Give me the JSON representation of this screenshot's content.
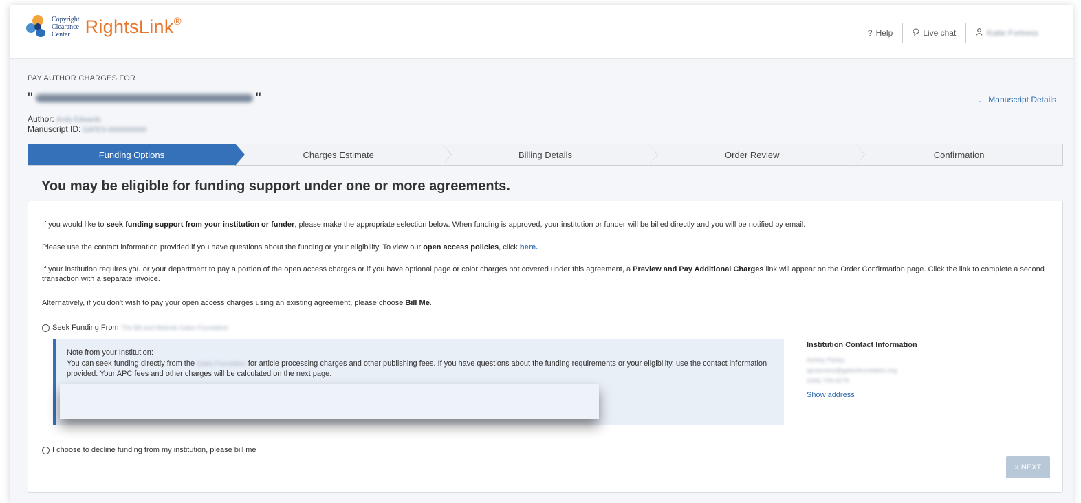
{
  "header": {
    "logo_line1": "Copyright",
    "logo_line2": "Clearance",
    "logo_line3": "Center",
    "brand": "RightsLink",
    "brand_mark": "®",
    "help": "Help",
    "help_icon": "question-icon",
    "live_chat": "Live chat",
    "chat_icon": "chat-bubble-icon",
    "user_icon": "user-icon",
    "user_name": "Katie Fortress"
  },
  "manuscript": {
    "pay_label": "PAY AUTHOR CHARGES FOR",
    "quote_open": "\"",
    "quote_close": "\"",
    "title_redacted": "Test-manuscript-FinalTitle",
    "author_label": "Author:",
    "author_value": "Andy Edwards",
    "id_label": "Manuscript ID:",
    "id_value": "GATES-0000000000",
    "details_link": "Manuscript Details",
    "details_icon": "chevron-down-icon"
  },
  "steps": [
    {
      "label": "Funding Options",
      "active": true
    },
    {
      "label": "Charges Estimate",
      "active": false
    },
    {
      "label": "Billing Details",
      "active": false
    },
    {
      "label": "Order Review",
      "active": false
    },
    {
      "label": "Confirmation",
      "active": false
    }
  ],
  "main": {
    "heading": "You may be eligible for funding support under one or more agreements.",
    "p1_a": "If you would like to ",
    "p1_b": "seek funding support from your institution or funder",
    "p1_c": ", please make the appropriate selection below. When funding is approved, your institution or funder will be billed directly and you will be notified by email.",
    "p2_a": "Please use the contact information provided if you have questions about the funding or your eligibility. To view our ",
    "p2_b": "open access policies",
    "p2_c": ", click ",
    "p2_link": "here.",
    "p3_a": "If your institution requires you or your department to pay a portion of the open access charges or if you have optional page or color charges not covered under this agreement, a ",
    "p3_b": "Preview and Pay Additional Charges",
    "p3_c": " link will appear on the Order Confirmation page. Click the link to complete a second transaction with a separate invoice.",
    "p4_a": "Alternatively, if you don't wish to pay your open access charges using an existing agreement, please choose ",
    "p4_b": "Bill Me",
    "p4_c": ".",
    "seek_label": "Seek Funding From",
    "seek_org": "The Bill and Melinda Gates Foundation",
    "note_title": "Note from your Institution:",
    "note_a": "You can seek funding directly from the ",
    "note_org": "Gates Foundation",
    "note_b": " for article processing charges and other publishing fees. If you have questions about the funding requirements or your eligibility, use the contact information provided.  Your APC fees and other charges will be calculated on the next page.",
    "contact_title": "Institution Contact Information",
    "contact_name": "Ashley Parley",
    "contact_email": "apcaccess@gatesfoundation.org",
    "contact_phone": "(206) 709-4279",
    "show_address": "Show address",
    "decline_label": "I choose to decline funding from my institution, please bill me",
    "next_label": "» NEXT"
  }
}
